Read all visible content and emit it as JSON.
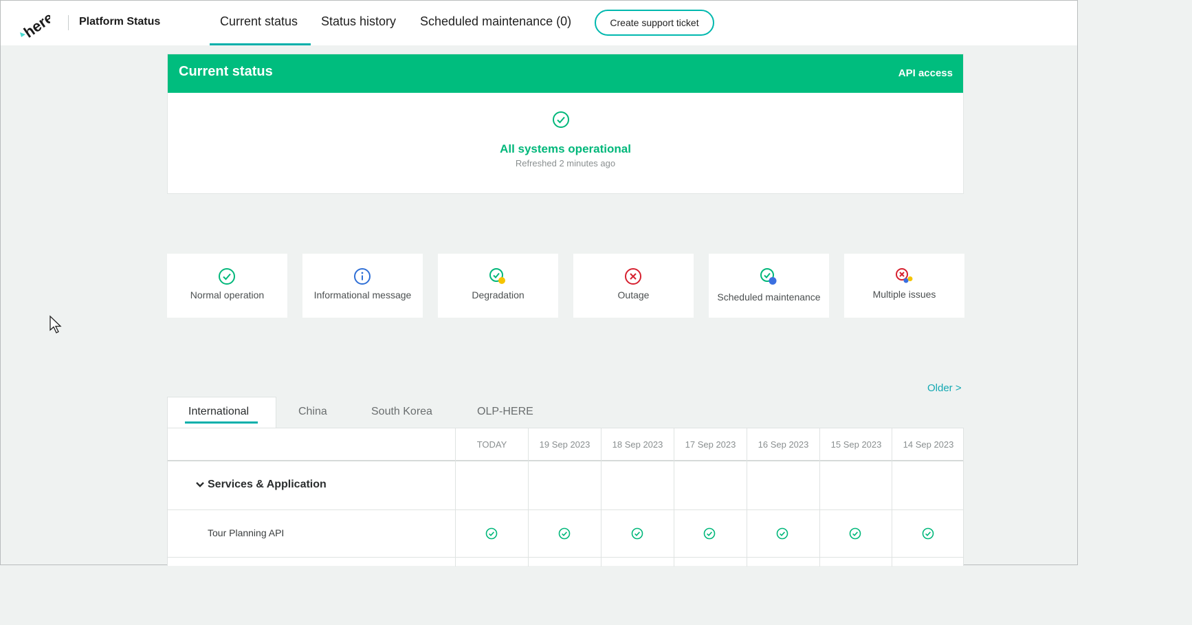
{
  "header": {
    "logo_text": "here",
    "title": "Platform Status",
    "tabs": [
      {
        "label": "Current status",
        "active": true
      },
      {
        "label": "Status history",
        "active": false
      },
      {
        "label": "Scheduled maintenance (0)",
        "active": false
      }
    ],
    "support_button": "Create support ticket"
  },
  "status": {
    "title": "Current status",
    "link": "API access",
    "message": "All systems operational",
    "refreshed": "Refreshed 2 minutes ago",
    "icon": "check-circle-icon"
  },
  "legend": [
    {
      "label": "Normal operation",
      "icon": "check-circle-icon"
    },
    {
      "label": "Informational message",
      "icon": "info-circle-icon"
    },
    {
      "label": "Degradation",
      "icon": "degradation-icon"
    },
    {
      "label": "Outage",
      "icon": "outage-icon"
    },
    {
      "label": "Scheduled maintenance",
      "icon": "maintenance-icon"
    },
    {
      "label": "Multiple issues",
      "icon": "multiple-issues-icon"
    }
  ],
  "older_link": "Older >",
  "regions": [
    {
      "label": "International",
      "active": true
    },
    {
      "label": "China",
      "active": false
    },
    {
      "label": "South Korea",
      "active": false
    },
    {
      "label": "OLP-HERE",
      "active": false
    }
  ],
  "table": {
    "columns": [
      "TODAY",
      "19 Sep 2023",
      "18 Sep 2023",
      "17 Sep 2023",
      "16 Sep 2023",
      "15 Sep 2023",
      "14 Sep 2023"
    ],
    "group": "Services & Application",
    "rows": [
      {
        "name": "Tour Planning API",
        "statuses": [
          "normal",
          "normal",
          "normal",
          "normal",
          "normal",
          "normal",
          "normal"
        ]
      }
    ]
  },
  "colors": {
    "brand_green": "#00bd7e",
    "accent_teal": "#00afaa",
    "info_blue": "#2f6fd6",
    "outage_red": "#d6202f",
    "degradation_yellow": "#f5c400",
    "maintenance_blue": "#3a6fe0"
  }
}
